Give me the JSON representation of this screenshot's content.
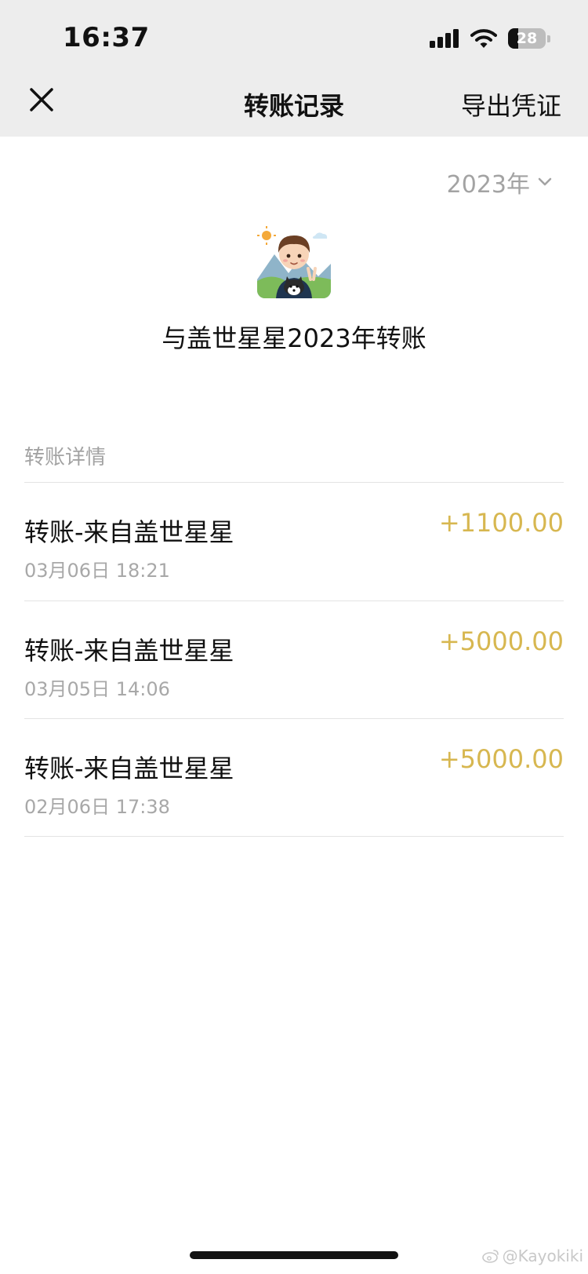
{
  "status_bar": {
    "time": "16:37",
    "battery": "28",
    "battery_level": 0.28,
    "icons": [
      "signal-icon",
      "wifi-icon",
      "battery-icon"
    ]
  },
  "nav": {
    "close_icon": "close-icon",
    "title": "转账记录",
    "export_label": "导出凭证"
  },
  "filter": {
    "year": "2023年",
    "chevron_icon": "chevron-down-icon"
  },
  "summary": {
    "title": "与盖世星星2023年转账"
  },
  "section": {
    "label": "转账详情"
  },
  "records": [
    {
      "title": "转账-来自盖世星星",
      "time": "03月06日 18:21",
      "amount": "+1100.00"
    },
    {
      "title": "转账-来自盖世星星",
      "time": "03月05日 14:06",
      "amount": "+5000.00"
    },
    {
      "title": "转账-来自盖世星星",
      "time": "02月06日 17:38",
      "amount": "+5000.00"
    }
  ],
  "watermark": "@Kayokiki",
  "colors": {
    "amount": "#d7b750",
    "secondary_text": "#a3a3a3",
    "top_band": "#ededed"
  }
}
